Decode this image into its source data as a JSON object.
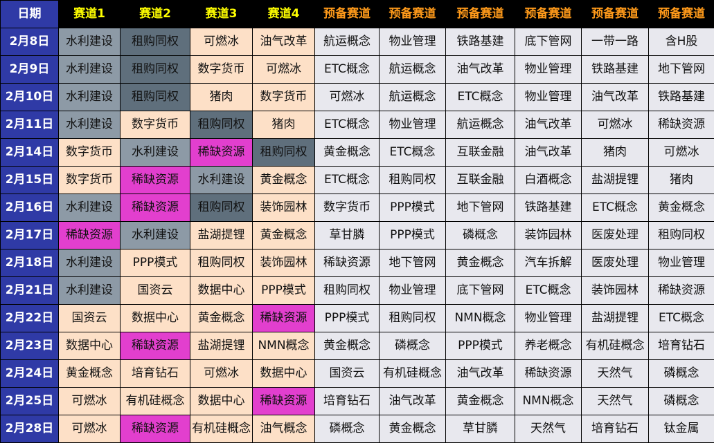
{
  "header": {
    "date": "日期",
    "tracks": [
      "赛道1",
      "赛道2",
      "赛道3",
      "赛道4",
      "预备赛道",
      "预备赛道",
      "预备赛道",
      "预备赛道",
      "预备赛道",
      "预备赛道"
    ]
  },
  "legend_colors": {
    "header_background": "#000000",
    "date_column": "#2f3aa6",
    "track_header_text": "#ffff00",
    "reserve_header_text": "#ff9a1a",
    "blue_gray": "#8d9aa6",
    "dark_slate": "#5f6f7c",
    "peach": "#fde0c7",
    "magenta": "#e23fce",
    "light_gray": "#e8e8ee"
  },
  "rows": [
    {
      "date": "2月8日",
      "cells": [
        {
          "text": "水利建设",
          "color": "blue"
        },
        {
          "text": "租购同权",
          "color": "dark"
        },
        {
          "text": "可燃冰",
          "color": "peach"
        },
        {
          "text": "油气改革",
          "color": "peach"
        },
        {
          "text": "航运概念",
          "color": "light"
        },
        {
          "text": "物业管理",
          "color": "light"
        },
        {
          "text": "铁路基建",
          "color": "light"
        },
        {
          "text": "底下管网",
          "color": "light"
        },
        {
          "text": "一带一路",
          "color": "light"
        },
        {
          "text": "含H股",
          "color": "light"
        }
      ]
    },
    {
      "date": "2月9日",
      "cells": [
        {
          "text": "水利建设",
          "color": "blue"
        },
        {
          "text": "租购同权",
          "color": "dark"
        },
        {
          "text": "数字货币",
          "color": "peach"
        },
        {
          "text": "可燃冰",
          "color": "peach"
        },
        {
          "text": "ETC概念",
          "color": "light"
        },
        {
          "text": "航运概念",
          "color": "light"
        },
        {
          "text": "油气改革",
          "color": "light"
        },
        {
          "text": "物业管理",
          "color": "light"
        },
        {
          "text": "铁路基建",
          "color": "light"
        },
        {
          "text": "地下管网",
          "color": "light"
        }
      ]
    },
    {
      "date": "2月10日",
      "cells": [
        {
          "text": "水利建设",
          "color": "blue"
        },
        {
          "text": "租购同权",
          "color": "dark"
        },
        {
          "text": "猪肉",
          "color": "peach"
        },
        {
          "text": "数字货币",
          "color": "peach"
        },
        {
          "text": "可燃冰",
          "color": "light"
        },
        {
          "text": "航运概念",
          "color": "light"
        },
        {
          "text": "ETC概念",
          "color": "light"
        },
        {
          "text": "物业管理",
          "color": "light"
        },
        {
          "text": "油气改革",
          "color": "light"
        },
        {
          "text": "铁路基建",
          "color": "light"
        }
      ]
    },
    {
      "date": "2月11日",
      "cells": [
        {
          "text": "水利建设",
          "color": "blue"
        },
        {
          "text": "数字货币",
          "color": "peach"
        },
        {
          "text": "租购同权",
          "color": "dark"
        },
        {
          "text": "猪肉",
          "color": "peach"
        },
        {
          "text": "ETC概念",
          "color": "light"
        },
        {
          "text": "物业管理",
          "color": "light"
        },
        {
          "text": "航运概念",
          "color": "light"
        },
        {
          "text": "油气改革",
          "color": "light"
        },
        {
          "text": "可燃冰",
          "color": "light"
        },
        {
          "text": "稀缺资源",
          "color": "light"
        }
      ]
    },
    {
      "date": "2月14日",
      "cells": [
        {
          "text": "数字货币",
          "color": "peach"
        },
        {
          "text": "水利建设",
          "color": "blue"
        },
        {
          "text": "稀缺资源",
          "color": "mag"
        },
        {
          "text": "租购同权",
          "color": "dark"
        },
        {
          "text": "黄金概念",
          "color": "light"
        },
        {
          "text": "ETC概念",
          "color": "light"
        },
        {
          "text": "互联金融",
          "color": "light"
        },
        {
          "text": "油气改革",
          "color": "light"
        },
        {
          "text": "猪肉",
          "color": "light"
        },
        {
          "text": "可燃冰",
          "color": "light"
        }
      ]
    },
    {
      "date": "2月15日",
      "cells": [
        {
          "text": "数字货币",
          "color": "peach"
        },
        {
          "text": "稀缺资源",
          "color": "mag"
        },
        {
          "text": "水利建设",
          "color": "blue"
        },
        {
          "text": "黄金概念",
          "color": "peach"
        },
        {
          "text": "ETC概念",
          "color": "light"
        },
        {
          "text": "租购同权",
          "color": "light"
        },
        {
          "text": "互联金融",
          "color": "light"
        },
        {
          "text": "白酒概念",
          "color": "light"
        },
        {
          "text": "盐湖提锂",
          "color": "light"
        },
        {
          "text": "猪肉",
          "color": "light"
        }
      ]
    },
    {
      "date": "2月16日",
      "cells": [
        {
          "text": "水利建设",
          "color": "blue"
        },
        {
          "text": "稀缺资源",
          "color": "mag"
        },
        {
          "text": "租购同权",
          "color": "dark"
        },
        {
          "text": "装饰园林",
          "color": "peach"
        },
        {
          "text": "数字货币",
          "color": "light"
        },
        {
          "text": "PPP模式",
          "color": "light"
        },
        {
          "text": "地下管网",
          "color": "light"
        },
        {
          "text": "铁路基建",
          "color": "light"
        },
        {
          "text": "ETC概念",
          "color": "light"
        },
        {
          "text": "黄金概念",
          "color": "light"
        }
      ]
    },
    {
      "date": "2月17日",
      "cells": [
        {
          "text": "稀缺资源",
          "color": "mag"
        },
        {
          "text": "水利建设",
          "color": "blue"
        },
        {
          "text": "盐湖提锂",
          "color": "peach"
        },
        {
          "text": "黄金概念",
          "color": "peach"
        },
        {
          "text": "草甘膦",
          "color": "light"
        },
        {
          "text": "PPP模式",
          "color": "light"
        },
        {
          "text": "磷概念",
          "color": "light"
        },
        {
          "text": "装饰园林",
          "color": "light"
        },
        {
          "text": "医废处理",
          "color": "light"
        },
        {
          "text": "租购同权",
          "color": "light"
        }
      ]
    },
    {
      "date": "2月18日",
      "cells": [
        {
          "text": "水利建设",
          "color": "blue"
        },
        {
          "text": "PPP模式",
          "color": "peach"
        },
        {
          "text": "租购同权",
          "color": "peach"
        },
        {
          "text": "装饰园林",
          "color": "peach"
        },
        {
          "text": "稀缺资源",
          "color": "light"
        },
        {
          "text": "地下管网",
          "color": "light"
        },
        {
          "text": "黄金概念",
          "color": "light"
        },
        {
          "text": "汽车拆解",
          "color": "light"
        },
        {
          "text": "医废处理",
          "color": "light"
        },
        {
          "text": "物业管理",
          "color": "light"
        }
      ]
    },
    {
      "date": "2月21日",
      "cells": [
        {
          "text": "水利建设",
          "color": "blue"
        },
        {
          "text": "国资云",
          "color": "peach"
        },
        {
          "text": "数据中心",
          "color": "peach"
        },
        {
          "text": "PPP模式",
          "color": "peach"
        },
        {
          "text": "租购同权",
          "color": "light"
        },
        {
          "text": "物业管理",
          "color": "light"
        },
        {
          "text": "底下管网",
          "color": "light"
        },
        {
          "text": "ETC概念",
          "color": "light"
        },
        {
          "text": "装饰园林",
          "color": "light"
        },
        {
          "text": "稀缺资源",
          "color": "light"
        }
      ]
    },
    {
      "date": "2月22日",
      "cells": [
        {
          "text": "国资云",
          "color": "peach"
        },
        {
          "text": "数据中心",
          "color": "peach"
        },
        {
          "text": "黄金概念",
          "color": "peach"
        },
        {
          "text": "稀缺资源",
          "color": "mag"
        },
        {
          "text": "PPP模式",
          "color": "light"
        },
        {
          "text": "租购同权",
          "color": "light"
        },
        {
          "text": "NMN概念",
          "color": "light"
        },
        {
          "text": "物业管理",
          "color": "light"
        },
        {
          "text": "盐湖提锂",
          "color": "light"
        },
        {
          "text": "ETC概念",
          "color": "light"
        }
      ]
    },
    {
      "date": "2月23日",
      "cells": [
        {
          "text": "数据中心",
          "color": "peach"
        },
        {
          "text": "稀缺资源",
          "color": "mag"
        },
        {
          "text": "盐湖提锂",
          "color": "peach"
        },
        {
          "text": "NMN概念",
          "color": "peach"
        },
        {
          "text": "黄金概念",
          "color": "light"
        },
        {
          "text": "磷概念",
          "color": "light"
        },
        {
          "text": "PPP模式",
          "color": "light"
        },
        {
          "text": "养老概念",
          "color": "light"
        },
        {
          "text": "有机硅概念",
          "color": "light"
        },
        {
          "text": "培育钻石",
          "color": "light"
        }
      ]
    },
    {
      "date": "2月24日",
      "cells": [
        {
          "text": "黄金概念",
          "color": "peach"
        },
        {
          "text": "培育钻石",
          "color": "peach"
        },
        {
          "text": "可燃冰",
          "color": "peach"
        },
        {
          "text": "数据中心",
          "color": "peach"
        },
        {
          "text": "国资云",
          "color": "light"
        },
        {
          "text": "有机硅概念",
          "color": "light"
        },
        {
          "text": "油气改革",
          "color": "light"
        },
        {
          "text": "稀缺资源",
          "color": "light"
        },
        {
          "text": "天然气",
          "color": "light"
        },
        {
          "text": "磷概念",
          "color": "light"
        }
      ]
    },
    {
      "date": "2月25日",
      "cells": [
        {
          "text": "可燃冰",
          "color": "peach"
        },
        {
          "text": "有机硅概念",
          "color": "peach"
        },
        {
          "text": "数据中心",
          "color": "peach"
        },
        {
          "text": "稀缺资源",
          "color": "mag"
        },
        {
          "text": "培育钻石",
          "color": "light"
        },
        {
          "text": "油气改革",
          "color": "light"
        },
        {
          "text": "黄金概念",
          "color": "light"
        },
        {
          "text": "NMN概念",
          "color": "light"
        },
        {
          "text": "天然气",
          "color": "light"
        },
        {
          "text": "磷概念",
          "color": "light"
        }
      ]
    },
    {
      "date": "2月28日",
      "cells": [
        {
          "text": "可燃冰",
          "color": "peach"
        },
        {
          "text": "稀缺资源",
          "color": "mag"
        },
        {
          "text": "有机硅概念",
          "color": "peach"
        },
        {
          "text": "油气概念",
          "color": "peach"
        },
        {
          "text": "磷概念",
          "color": "light"
        },
        {
          "text": "黄金概念",
          "color": "light"
        },
        {
          "text": "草甘膦",
          "color": "light"
        },
        {
          "text": "天然气",
          "color": "light"
        },
        {
          "text": "培育钻石",
          "color": "light"
        },
        {
          "text": "钛金属",
          "color": "light"
        }
      ]
    }
  ]
}
